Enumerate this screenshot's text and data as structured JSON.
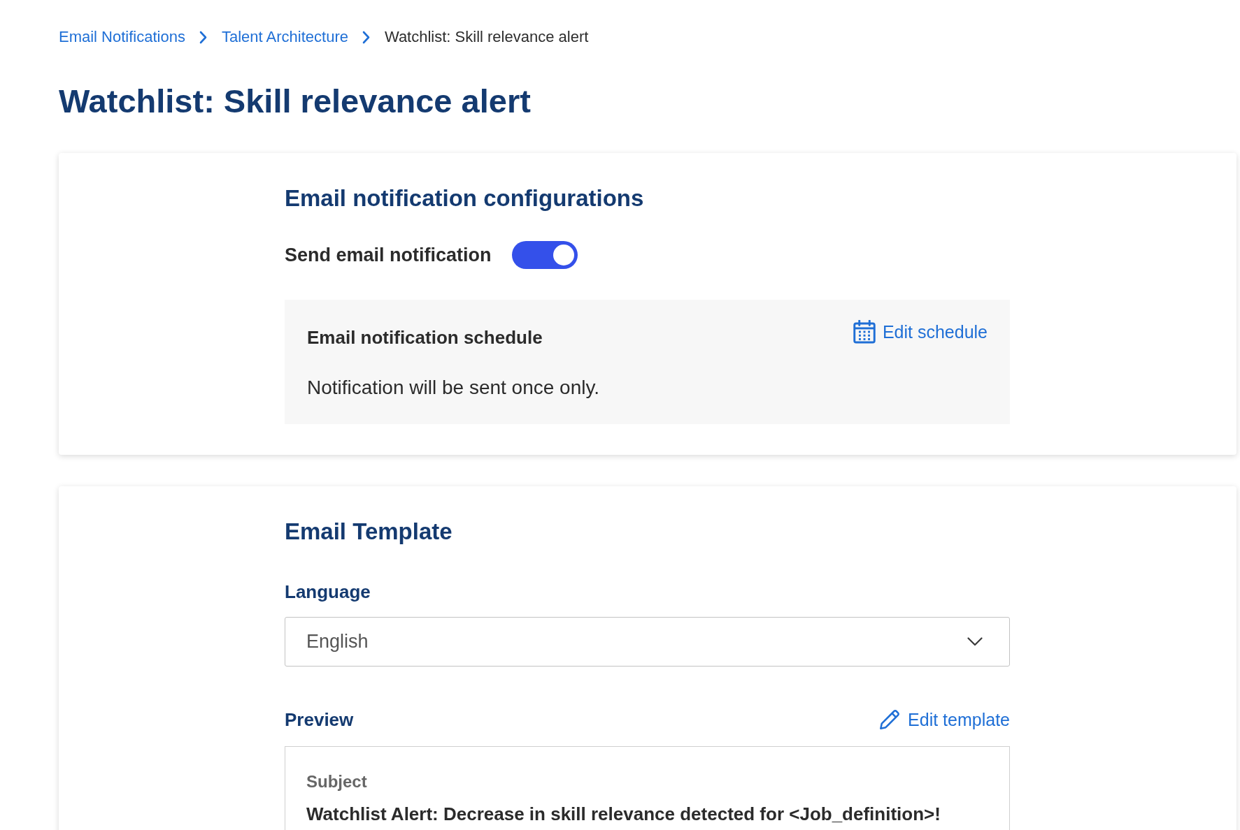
{
  "breadcrumb": [
    {
      "label": "Email Notifications",
      "kind": "link"
    },
    {
      "label": "Talent Architecture",
      "kind": "link"
    },
    {
      "label": "Watchlist: Skill relevance alert",
      "kind": "current"
    }
  ],
  "title": "Watchlist: Skill relevance alert",
  "configuration_card": {
    "heading": "Email notification configurations",
    "send_toggle": {
      "label": "Send email notification",
      "on": true
    },
    "schedule": {
      "heading": "Email notification schedule",
      "edit_link": "Edit schedule",
      "description": "Notification will be sent once only."
    }
  },
  "template_card": {
    "heading": "Email Template",
    "language": {
      "label": "Language",
      "value": "English"
    },
    "preview": {
      "label": "Preview",
      "edit_link": "Edit template",
      "subject_label": "Subject",
      "subject": "Watchlist Alert: Decrease in skill relevance detected for <Job_definition>!"
    }
  }
}
